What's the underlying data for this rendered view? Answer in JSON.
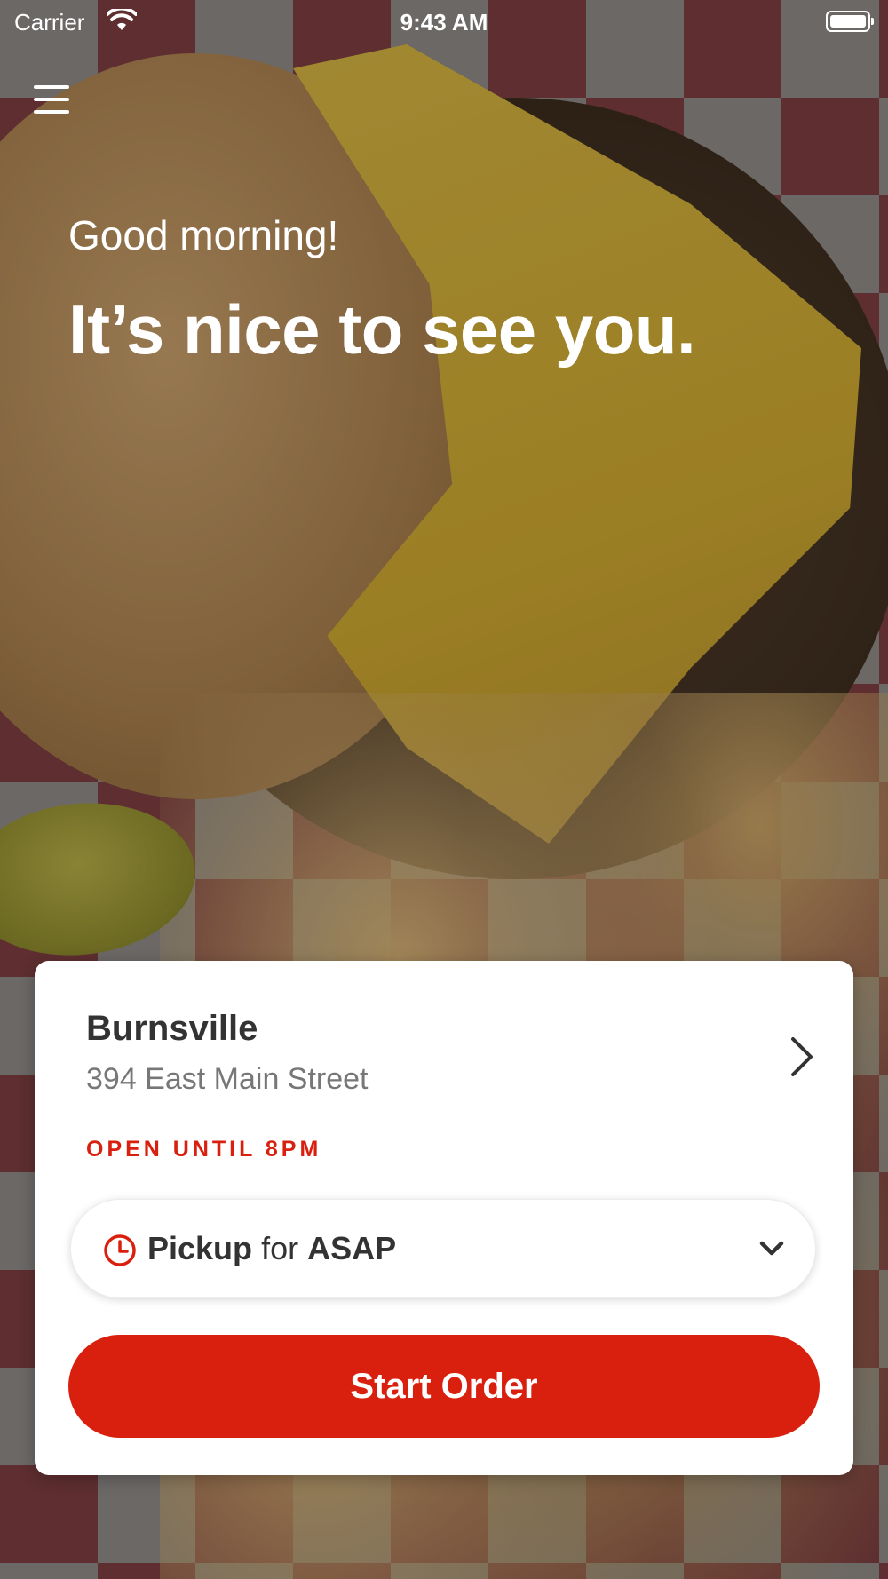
{
  "status_bar": {
    "carrier": "Carrier",
    "time": "9:43 AM"
  },
  "hero": {
    "greeting": "Good morning!",
    "headline": "It’s nice to see you."
  },
  "location": {
    "name": "Burnsville",
    "address": "394 East Main Street",
    "hours": "OPEN UNTIL 8PM"
  },
  "order_mode": {
    "mode": "Pickup",
    "connector": "for",
    "time": "ASAP"
  },
  "actions": {
    "start_order_label": "Start Order"
  },
  "icons": [
    "hamburger-menu-icon",
    "wifi-icon",
    "battery-icon",
    "chevron-right-icon",
    "clock-icon",
    "chevron-down-icon"
  ],
  "colors": {
    "accent": "#d9200f",
    "card_background": "#ffffff",
    "title_text": "#333333",
    "secondary_text": "#777777"
  }
}
